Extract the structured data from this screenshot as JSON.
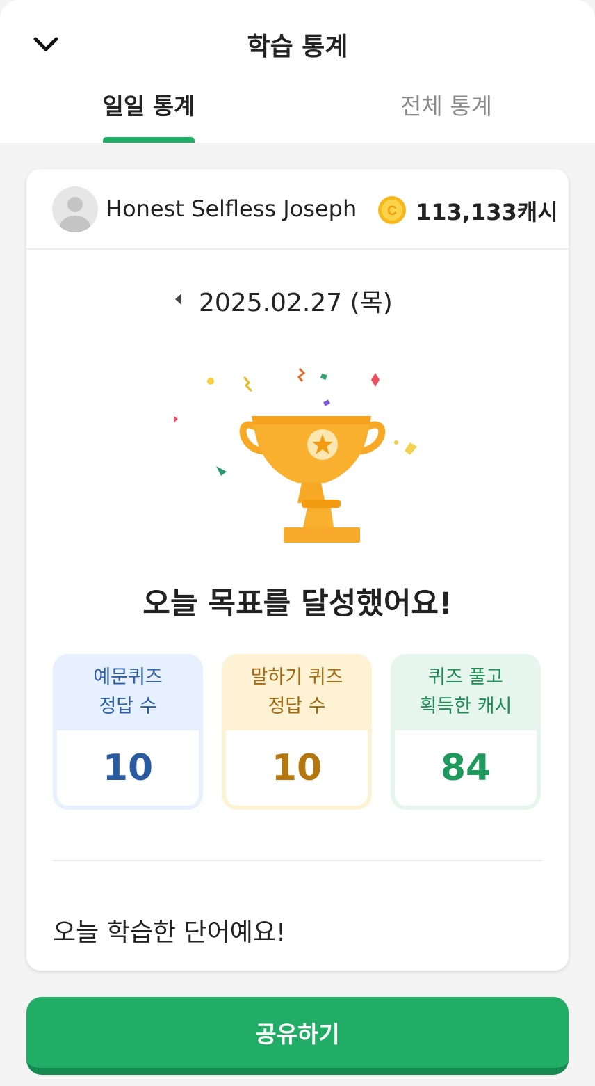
{
  "header": {
    "title": "학습 통계",
    "back_icon": "chevron-down-icon"
  },
  "tabs": [
    {
      "label": "일일 통계",
      "active": true
    },
    {
      "label": "전체 통계",
      "active": false
    }
  ],
  "profile": {
    "name": "Honest Selfless Joseph",
    "cash": "113,133캐시",
    "coin_icon": "coin-icon"
  },
  "date": {
    "text": "2025.02.27 (목)",
    "prev_icon": "triangle-left-icon"
  },
  "goal_message": "오늘 목표를 달성했어요!",
  "stats": [
    {
      "line1": "예문퀴즈",
      "line2": "정답 수",
      "value": "10",
      "color": "#2a5aa0"
    },
    {
      "line1": "말하기 퀴즈",
      "line2": "정답 수",
      "value": "10",
      "color": "#b5760e"
    },
    {
      "line1": "퀴즈 풀고",
      "line2": "획득한 캐시",
      "value": "84",
      "color": "#1e9a5c"
    }
  ],
  "words_title": "오늘 학습한 단어예요!",
  "share_button": "공유하기",
  "colors": {
    "accent": "#22ad66",
    "trophy": "#f7a825"
  }
}
